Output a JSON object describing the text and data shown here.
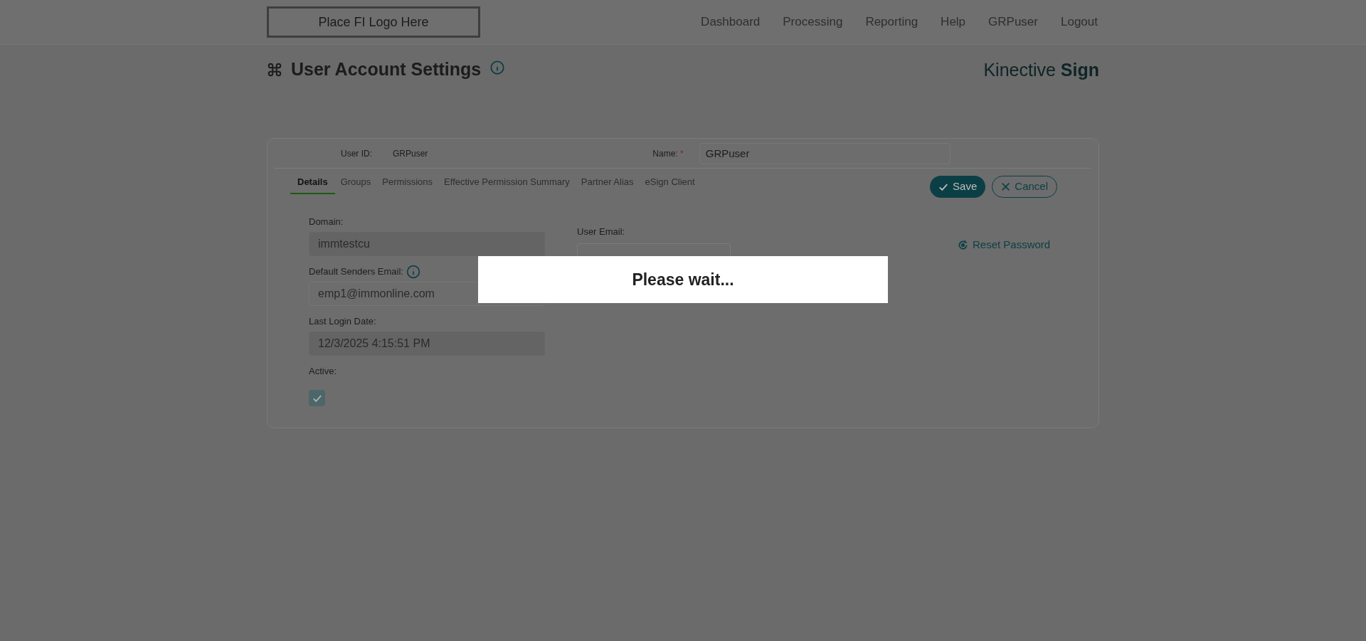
{
  "header": {
    "logo": "Place FI Logo Here",
    "nav": [
      "Dashboard",
      "Processing",
      "Reporting",
      "Help",
      "GRPuser",
      "Logout"
    ]
  },
  "page": {
    "title": "User Account Settings",
    "brand": "Kinective **Sign**"
  },
  "user": {
    "user_id_label": "User ID:",
    "user_id": "GRPuser",
    "name_label": "Name:",
    "required_mark": "*",
    "name": "GRPuser"
  },
  "tabs": [
    {
      "label": "Details",
      "selected": true
    },
    {
      "label": "Groups",
      "selected": false
    },
    {
      "label": "Permissions",
      "selected": false
    },
    {
      "label": "Effective Permission Summary",
      "selected": false
    },
    {
      "label": "Partner Alias",
      "selected": false
    },
    {
      "label": "eSign Client",
      "selected": false
    }
  ],
  "buttons": [
    {
      "kind": "save",
      "label": "Save"
    },
    {
      "kind": "cancel",
      "label": "Cancel"
    }
  ],
  "fields": [
    {
      "kind": "input",
      "label": "Domain:",
      "value": "immtestcu",
      "disabled": true,
      "info": false
    },
    {
      "kind": "input",
      "label": "Default Senders Email:",
      "value": "emp1@immonline.com",
      "disabled": false,
      "info": true
    },
    {
      "kind": "input",
      "label": "Last Login Date:",
      "value": "12/3/2025 4:15:51 PM",
      "disabled": true,
      "info": false
    },
    {
      "kind": "checkbox",
      "label": "Active:",
      "checked": true
    }
  ],
  "user_email": {
    "label": "User Email:"
  },
  "reset_password": "Reset Password",
  "modal": {
    "message": "Please wait..."
  }
}
